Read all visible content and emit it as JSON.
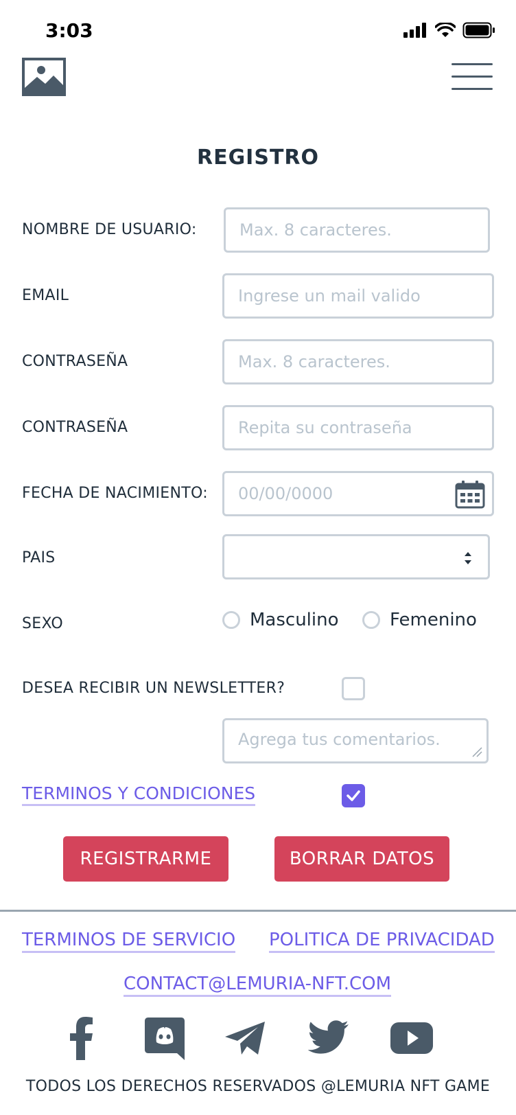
{
  "status_bar": {
    "time": "3:03"
  },
  "header": {
    "logo_icon": "image-icon",
    "menu_icon": "hamburger-menu-icon"
  },
  "form": {
    "title": "REGISTRO",
    "username": {
      "label": "NOMBRE DE USUARIO:",
      "placeholder": "Max. 8 caracteres.",
      "value": ""
    },
    "email": {
      "label": "EMAIL",
      "placeholder": "Ingrese un mail valido",
      "value": ""
    },
    "password": {
      "label": "CONTRASEÑA",
      "placeholder": "Max. 8 caracteres.",
      "value": ""
    },
    "password_confirm": {
      "label": "CONTRASEÑA",
      "placeholder": "Repita su contraseña",
      "value": ""
    },
    "birthdate": {
      "label": "FECHA DE NACIMIENTO:",
      "placeholder": "00/00/0000",
      "value": ""
    },
    "country": {
      "label": "PAIS",
      "value": ""
    },
    "sex": {
      "label": "SEXO",
      "options": [
        "Masculino",
        "Femenino"
      ],
      "selected": null
    },
    "newsletter": {
      "label": "DESEA RECIBIR UN NEWSLETTER?",
      "checked": false
    },
    "comments": {
      "placeholder": "Agrega tus comentarios.",
      "value": ""
    },
    "terms": {
      "label": "TERMINOS Y CONDICIONES",
      "checked": true
    },
    "submit_label": "REGISTRARME",
    "reset_label": "BORRAR DATOS"
  },
  "footer": {
    "links": [
      "TERMINOS DE SERVICIO",
      "POLITICA DE PRIVACIDAD"
    ],
    "contact_email": "CONTACT@LEMURIA-NFT.COM",
    "social_icons": [
      "facebook-icon",
      "discord-icon",
      "telegram-icon",
      "twitter-icon",
      "youtube-icon"
    ],
    "copyright": "TODOS LOS DERECHOS RESERVADOS @LEMURIA NFT GAME"
  },
  "colors": {
    "accent": "#6c5ce7",
    "button": "#d4445b",
    "text": "#1f2d3a",
    "border": "#c9d1d9",
    "icon": "#4a5a68"
  }
}
